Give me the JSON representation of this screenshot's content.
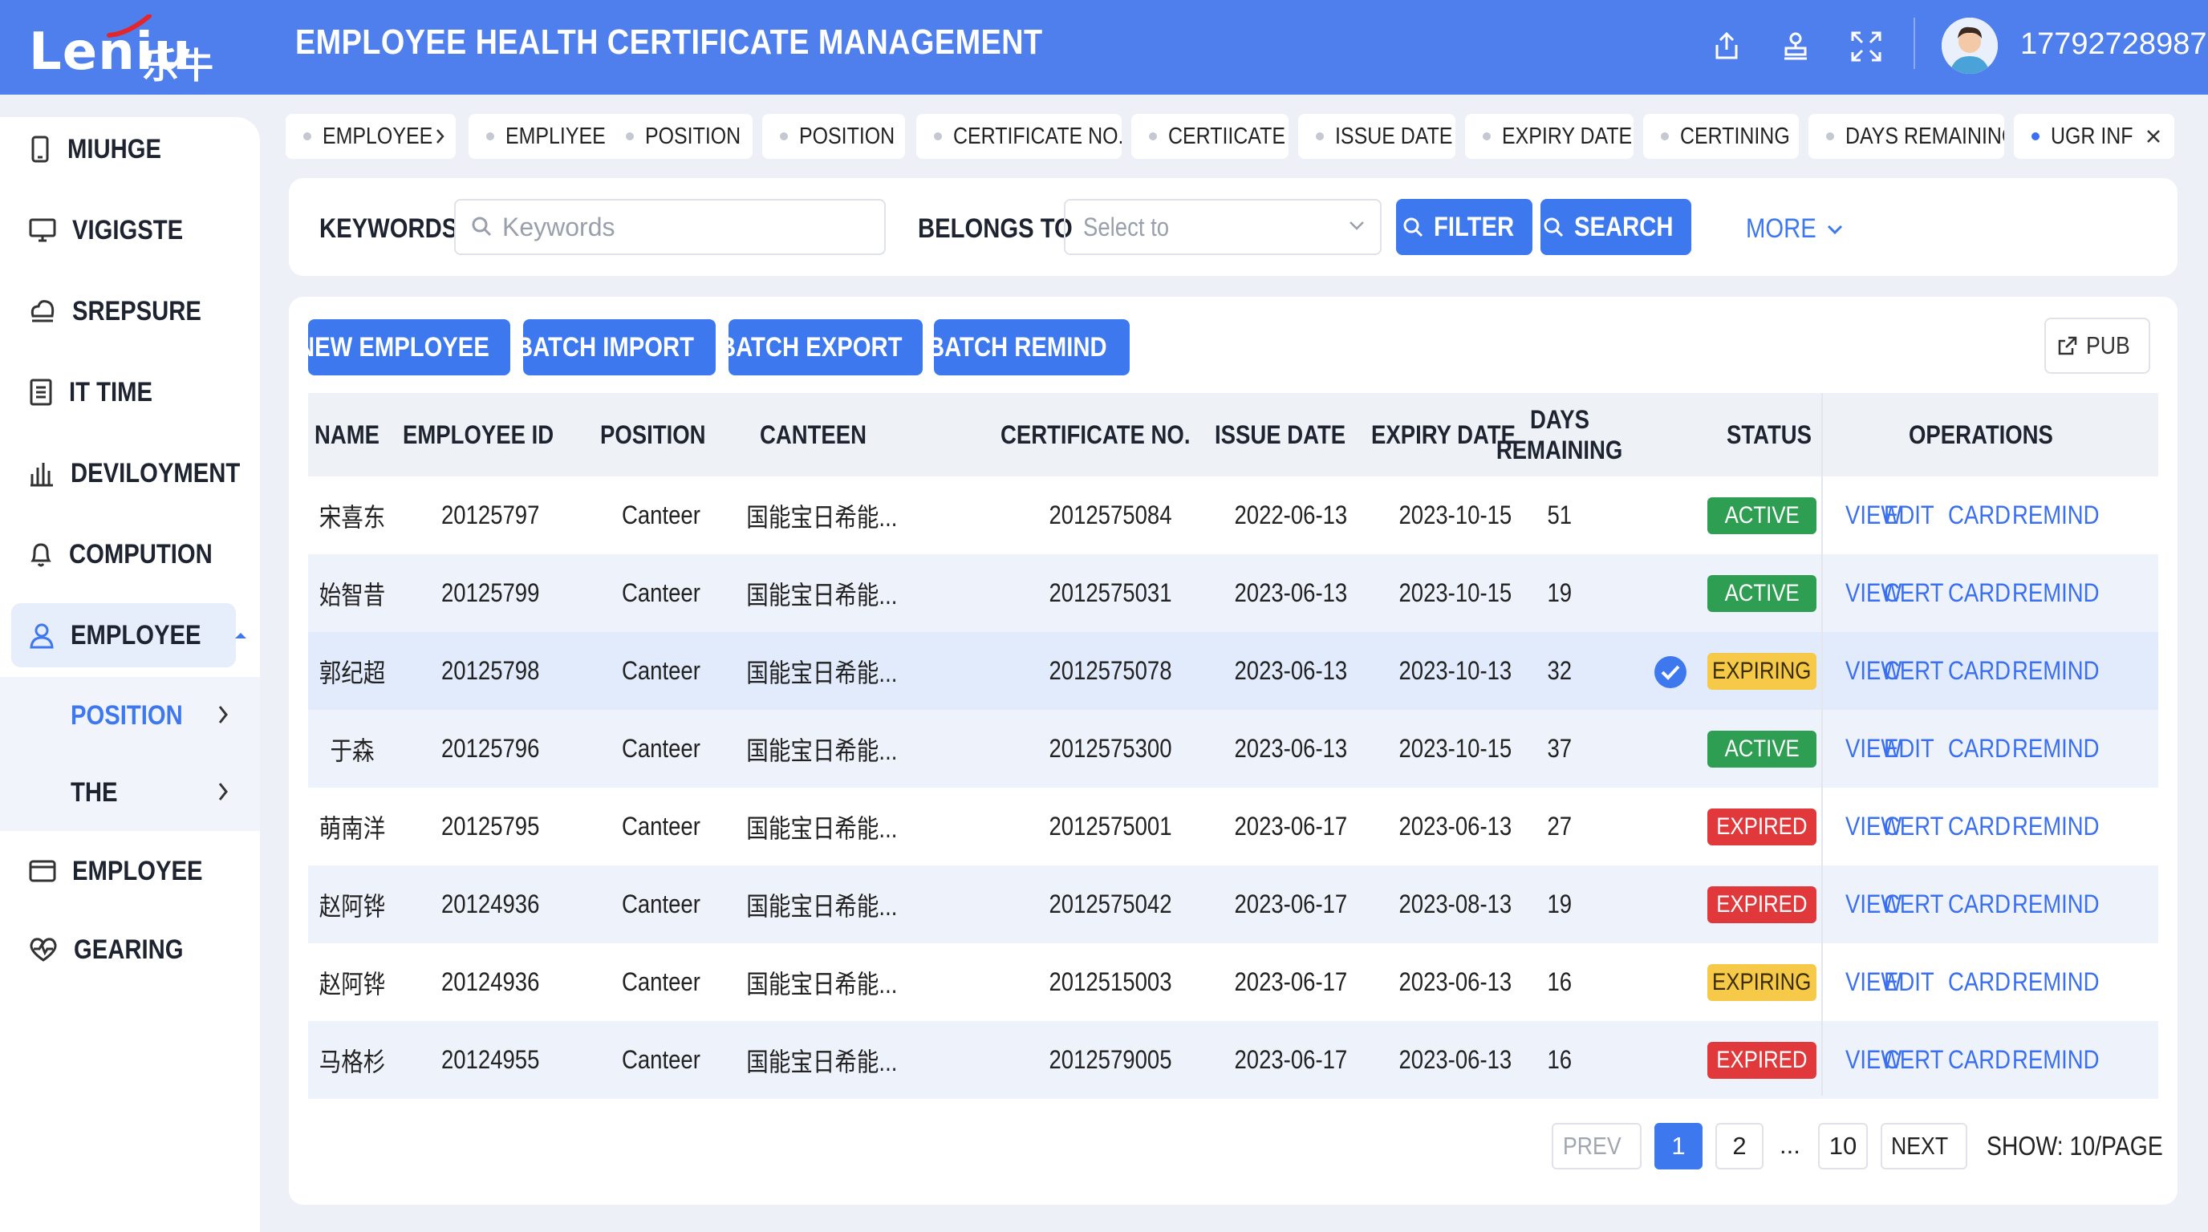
{
  "app": {
    "logo_text": "Leniu",
    "logo_cn": "乐牛",
    "title": "EMPLOYEE HEALTH CERTIFICATE MANAGEMENT",
    "user_phone": "17792728987"
  },
  "colors": {
    "primary": "#4f7fec",
    "active_green": "#2e9e52",
    "expiring_yellow": "#f7c948",
    "expired_red": "#e0383b",
    "link_blue": "#3a6ff0"
  },
  "sidebar": {
    "items": [
      {
        "label": "MIUHGE",
        "icon": "phone-icon"
      },
      {
        "label": "VIGIGSTE",
        "icon": "monitor-icon"
      },
      {
        "label": "SREPSURE",
        "icon": "chef-hat-icon"
      },
      {
        "label": "IT TIME",
        "icon": "document-list-icon"
      },
      {
        "label": "DEVILOYMENT",
        "icon": "bar-chart-icon"
      },
      {
        "label": "COMPUTION",
        "icon": "bell-icon"
      },
      {
        "label": "EMPLOYEE",
        "icon": "user-icon",
        "active": true
      },
      {
        "label": "EMPLOYEE",
        "icon": "card-icon"
      },
      {
        "label": "GEARING",
        "icon": "heart-pulse-icon"
      }
    ],
    "sub_items": [
      {
        "label": "POSITION",
        "active": true
      },
      {
        "label": "THE",
        "active": false
      }
    ]
  },
  "tabs": [
    "EMPLOYEE",
    "EMPLIYEE",
    "POSITION",
    "POSITION",
    "CERTIFICATE NO.",
    "CERTIICATE",
    "ISSUE DATE",
    "EXPIRY DATE",
    "CERTINING",
    "DAYS REMAINING",
    "UGR INF"
  ],
  "filter": {
    "keywords_label": "KEYWORDS",
    "keywords_placeholder": "Keywords",
    "belongs_label": "BELONGS TO",
    "belongs_placeholder": "Select to",
    "filter_btn": "FILTER",
    "search_btn": "SEARCH",
    "more_label": "MORE"
  },
  "actions": {
    "new_employee": "NEW EMPLOYEE",
    "batch_import": "BATCH IMPORT",
    "batch_export": "BATCH EXPORT",
    "batch_remind": "BATCH REMIND",
    "pub": "PUB"
  },
  "table": {
    "headers": {
      "name": "NAME",
      "employee_id": "EMPLOYEE ID",
      "position": "POSITION",
      "canteen": "CANTEEN",
      "certificate_no": "CERTIFICATE NO.",
      "issue_date": "ISSUE DATE",
      "expiry_date": "EXPIRY DATE",
      "days_line1": "DAYS",
      "days_line2": "REMAINING",
      "status": "STATUS",
      "operations": "OPERATIONS"
    },
    "rows": [
      {
        "name": "宋喜东",
        "id": "20125797",
        "position": "Canteer",
        "canteen": "国能宝日希能...",
        "cert": "2012575084",
        "issue": "2022-06-13",
        "expiry": "2023-10-15",
        "days": "51",
        "status": "ACTIVE",
        "ops": [
          "VIEW",
          "EDIT",
          "CARD",
          "REMIND"
        ]
      },
      {
        "name": "始智昔",
        "id": "20125799",
        "position": "Canteer",
        "canteen": "国能宝日希能...",
        "cert": "2012575031",
        "issue": "2023-06-13",
        "expiry": "2023-10-15",
        "days": "19",
        "status": "ACTIVE",
        "ops": [
          "VIEW",
          "CERT",
          "CARD",
          "REMIND"
        ]
      },
      {
        "name": "郭纪超",
        "id": "20125798",
        "position": "Canteer",
        "canteen": "国能宝日希能...",
        "cert": "2012575078",
        "issue": "2023-06-13",
        "expiry": "2023-10-13",
        "days": "32",
        "status": "EXPIRING",
        "ops": [
          "VIEW",
          "CERT",
          "CARD",
          "REMIND"
        ],
        "checked": true
      },
      {
        "name": "于森",
        "id": "20125796",
        "position": "Canteer",
        "canteen": "国能宝日希能...",
        "cert": "2012575300",
        "issue": "2023-06-13",
        "expiry": "2023-10-15",
        "days": "37",
        "status": "ACTIVE",
        "ops": [
          "VIEW",
          "EDIT",
          "CARD",
          "REMIND"
        ]
      },
      {
        "name": "萌南洋",
        "id": "20125795",
        "position": "Canteer",
        "canteen": "国能宝日希能...",
        "cert": "2012575001",
        "issue": "2023-06-17",
        "expiry": "2023-06-13",
        "days": "27",
        "status": "EXPIRED",
        "ops": [
          "VIEW",
          "CERT",
          "CARD",
          "REMIND"
        ]
      },
      {
        "name": "赵阿铧",
        "id": "20124936",
        "position": "Canteer",
        "canteen": "国能宝日希能...",
        "cert": "2012575042",
        "issue": "2023-06-17",
        "expiry": "2023-08-13",
        "days": "19",
        "status": "EXPIRED",
        "ops": [
          "VIEW",
          "CERT",
          "CARD",
          "REMIND"
        ]
      },
      {
        "name": "赵阿铧",
        "id": "20124936",
        "position": "Canteer",
        "canteen": "国能宝日希能...",
        "cert": "2012515003",
        "issue": "2023-06-17",
        "expiry": "2023-06-13",
        "days": "16",
        "status": "EXPIRING",
        "ops": [
          "VIEW",
          "EDIT",
          "CARD",
          "REMIND"
        ]
      },
      {
        "name": "马格杉",
        "id": "20124955",
        "position": "Canteer",
        "canteen": "国能宝日希能...",
        "cert": "2012579005",
        "issue": "2023-06-17",
        "expiry": "2023-06-13",
        "days": "16",
        "status": "EXPIRED",
        "ops": [
          "VIEW",
          "CERT",
          "CARD",
          "REMIND"
        ]
      }
    ]
  },
  "pagination": {
    "prev": "PREV",
    "pages": [
      "1",
      "2"
    ],
    "ellipsis": "...",
    "last": "10",
    "next": "NEXT",
    "show": "SHOW: 10/PAGE",
    "current": "1"
  }
}
